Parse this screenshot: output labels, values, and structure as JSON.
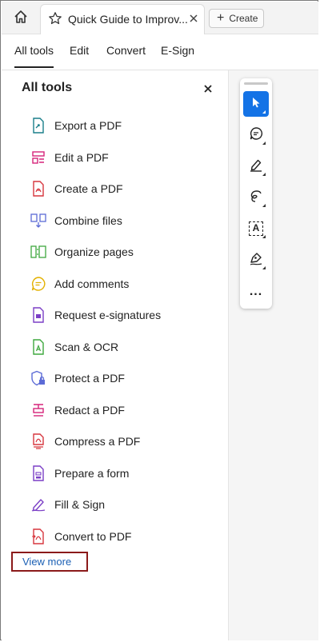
{
  "tabbar": {
    "doc_title": "Quick Guide to Improv...",
    "create_label": "Create",
    "create_plus": "+"
  },
  "nav": {
    "tabs": [
      {
        "label": "All tools",
        "active": true
      },
      {
        "label": "Edit"
      },
      {
        "label": "Convert"
      },
      {
        "label": "E-Sign"
      }
    ]
  },
  "panel": {
    "title": "All tools",
    "close_glyph": "×",
    "tools": [
      {
        "label": "Export a PDF",
        "icon": "export-pdf-icon",
        "color": "#1a7f8a"
      },
      {
        "label": "Edit a PDF",
        "icon": "edit-pdf-icon",
        "color": "#d6247a"
      },
      {
        "label": "Create a PDF",
        "icon": "create-pdf-icon",
        "color": "#d7373f"
      },
      {
        "label": "Combine files",
        "icon": "combine-files-icon",
        "color": "#5c6bd6"
      },
      {
        "label": "Organize pages",
        "icon": "organize-pages-icon",
        "color": "#3ea83e"
      },
      {
        "label": "Add comments",
        "icon": "add-comments-icon",
        "color": "#e3b100"
      },
      {
        "label": "Request e-signatures",
        "icon": "request-esignatures-icon",
        "color": "#7b3fc6"
      },
      {
        "label": "Scan & OCR",
        "icon": "scan-ocr-icon",
        "color": "#3ea83e"
      },
      {
        "label": "Protect a PDF",
        "icon": "protect-pdf-icon",
        "color": "#5c6bd6"
      },
      {
        "label": "Redact a PDF",
        "icon": "redact-pdf-icon",
        "color": "#d6247a"
      },
      {
        "label": "Compress a PDF",
        "icon": "compress-pdf-icon",
        "color": "#d7373f"
      },
      {
        "label": "Prepare a form",
        "icon": "prepare-form-icon",
        "color": "#7b3fc6"
      },
      {
        "label": "Fill & Sign",
        "icon": "fill-sign-icon",
        "color": "#7b3fc6"
      },
      {
        "label": "Convert to PDF",
        "icon": "convert-to-pdf-icon",
        "color": "#d7373f"
      }
    ],
    "view_more": "View more"
  },
  "toolbar": {
    "accent": "#1473e6",
    "more_glyph": "...",
    "text_tool_glyph": "A"
  }
}
